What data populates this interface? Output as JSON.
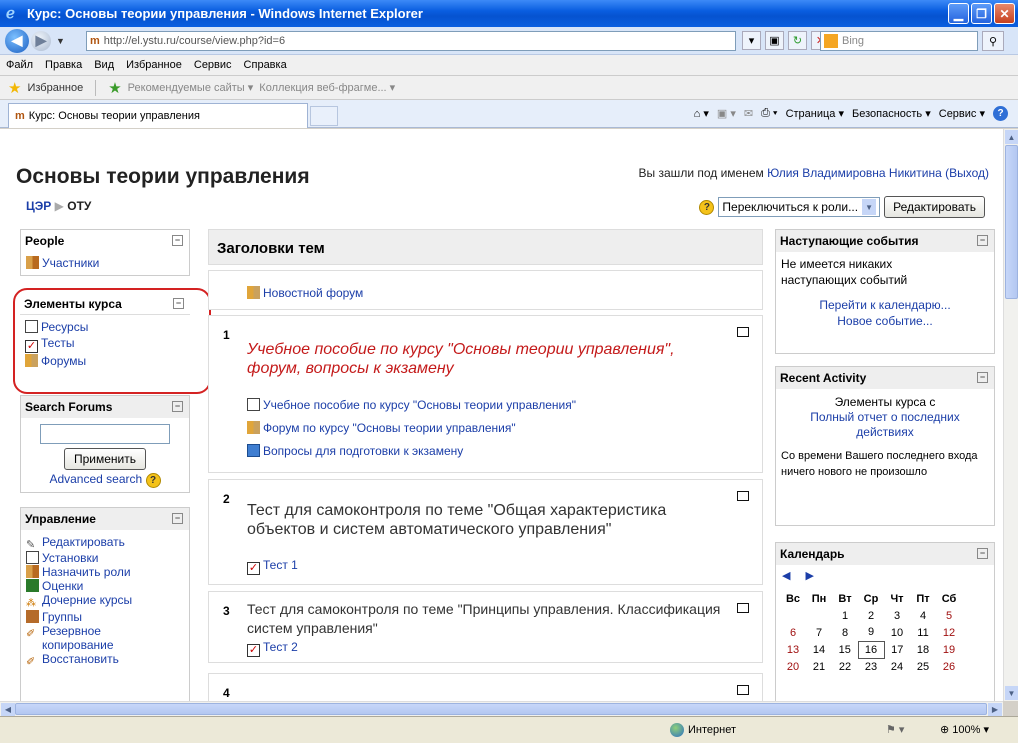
{
  "window": {
    "title": "Курс: Основы теории управления - Windows Internet Explorer",
    "url": "http://el.ystu.ru/course/view.php?id=6",
    "search_placeholder": "Bing",
    "menu": [
      "Файл",
      "Правка",
      "Вид",
      "Избранное",
      "Сервис",
      "Справка"
    ],
    "favorites": {
      "label": "Избранное",
      "links": [
        "Рекомендуемые сайты ▾",
        "Коллекция веб-фрагме... ▾"
      ]
    },
    "tab_title": "Курс: Основы теории управления",
    "commands": [
      "Страница ▾",
      "Безопасность ▾",
      "Сервис ▾"
    ],
    "status_zone": "Интернет",
    "zoom": "100%"
  },
  "page": {
    "course_title": "Основы теории управления",
    "login_prefix": "Вы зашли под именем ",
    "user_name": "Юлия Владимировна Никитина",
    "logout": "(Выход)",
    "breadcrumb": [
      "ЦЭР",
      "ОТУ"
    ],
    "role_select": "Переключиться к роли...",
    "edit_button": "Редактировать"
  },
  "left": {
    "people": {
      "title": "People",
      "items": [
        "Участники"
      ]
    },
    "elements": {
      "title": "Элементы курса",
      "items": [
        "Ресурсы",
        "Тесты",
        "Форумы"
      ]
    },
    "search": {
      "title": "Search Forums",
      "button": "Применить",
      "advanced": "Advanced search"
    },
    "admin": {
      "title": "Управление",
      "items": [
        "Редактировать",
        "Установки",
        "Назначить роли",
        "Оценки",
        "Дочерние курсы",
        "Группы",
        "Резервное копирование",
        "Восстановить"
      ]
    }
  },
  "center": {
    "header": "Заголовки тем",
    "news_forum": "Новостной форум",
    "sections": [
      {
        "num": "1",
        "title": "Учебное пособие по курсу \"Основы теории управления\", форум, вопросы к экзамену",
        "links": [
          "Учебное пособие по курсу \"Основы теории управления\"",
          "Форум по курсу \"Основы теории управления\"",
          "Вопросы для подготовки к экзамену"
        ]
      },
      {
        "num": "2",
        "title": "Тест для самоконтроля по теме \"Общая характеристика объектов и систем автоматического управления\"",
        "links": [
          "Тест 1"
        ]
      },
      {
        "num": "3",
        "title": "Тест для самоконтроля по теме \"Принципы управления. Классификация систем управления\"",
        "links": [
          "Тест 2"
        ]
      },
      {
        "num": "4",
        "title": "",
        "links": []
      }
    ]
  },
  "right": {
    "upcoming": {
      "title": "Наступающие события",
      "empty": "Не имеется никаких наступающих событий",
      "goto_calendar": "Перейти к календарю...",
      "new_event": "Новое событие..."
    },
    "recent": {
      "title": "Recent Activity",
      "since": "Элементы курса с",
      "full_report": "Полный отчет о последних действиях",
      "nothing": "Со времени Вашего последнего входа ничего нового не произошло"
    },
    "calendar": {
      "title": "Календарь",
      "weekdays": [
        "Вс",
        "Пн",
        "Вт",
        "Ср",
        "Чт",
        "Пт",
        "Сб"
      ],
      "weeks": [
        [
          "",
          "",
          "1",
          "2",
          "3",
          "4",
          "5"
        ],
        [
          "6",
          "7",
          "8",
          "9",
          "10",
          "11",
          "12"
        ],
        [
          "13",
          "14",
          "15",
          "16",
          "17",
          "18",
          "19"
        ],
        [
          "20",
          "21",
          "22",
          "23",
          "24",
          "25",
          "26"
        ]
      ],
      "today": "16"
    }
  },
  "colors": {
    "link": "#1b3ea8",
    "section1_title": "#c41a1a",
    "weekend": "#a01010",
    "highlight": "#d42222"
  }
}
